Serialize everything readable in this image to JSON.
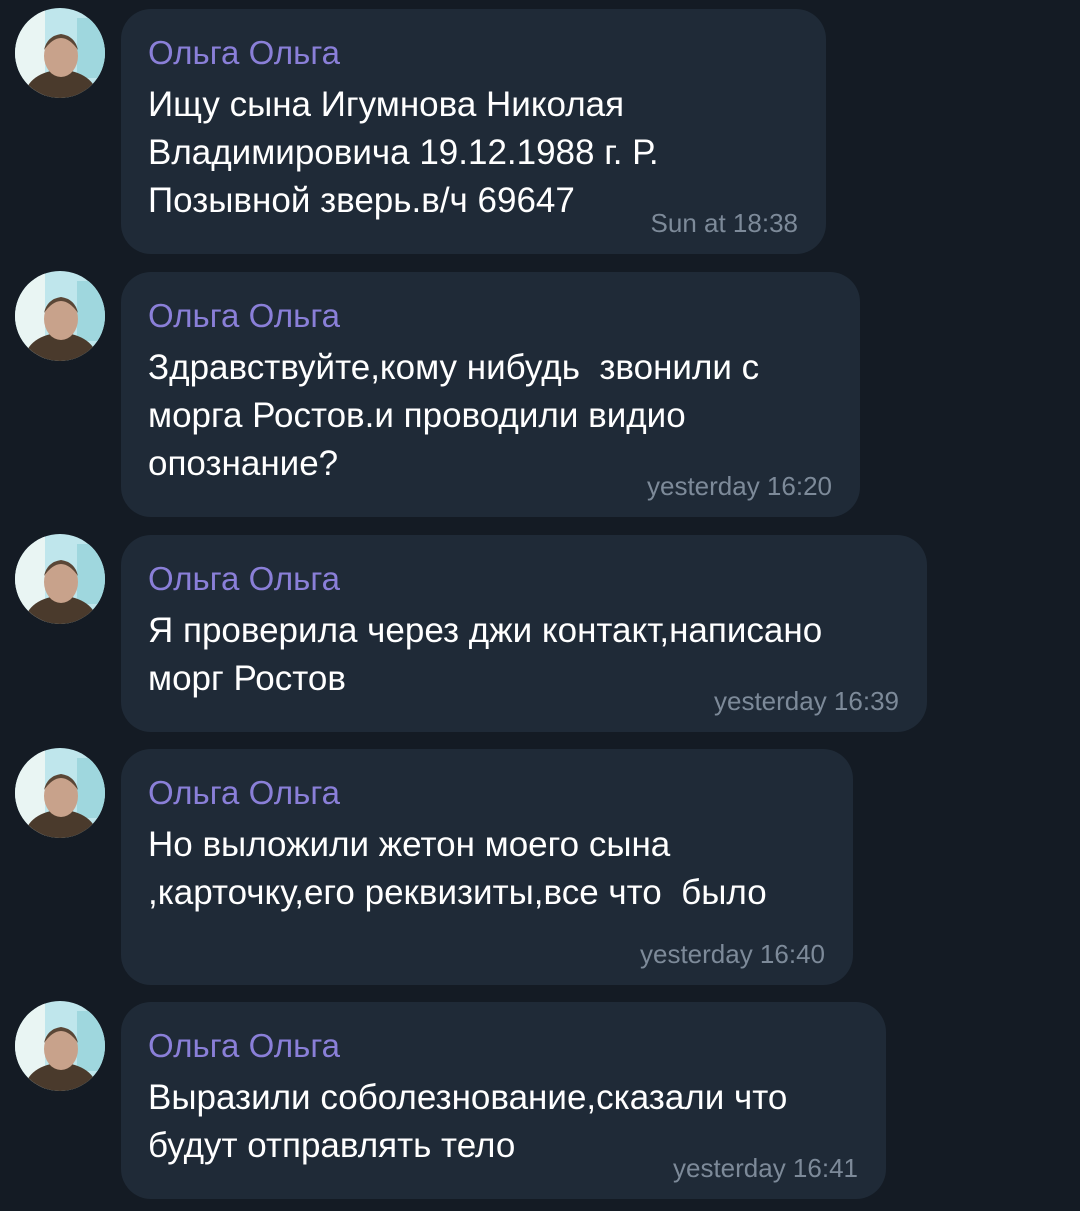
{
  "messages": [
    {
      "sender": "Ольга Ольга",
      "text": "Ищу сына Игумнова Николая\nВладимировича 19.12.1988 г. Р.\nПозывной зверь.в/ч 69647",
      "time": "Sun at 18:38"
    },
    {
      "sender": "Ольга Ольга",
      "text": "Здравствуйте,кому нибудь  звонили с\nморга Ростов.и проводили видио\nопознание?",
      "time": "yesterday 16:20"
    },
    {
      "sender": "Ольга Ольга",
      "text": "Я проверила через джи контакт,написано\nморг Ростов",
      "time": "yesterday 16:39"
    },
    {
      "sender": "Ольга Ольга",
      "text": "Но выложили жетон моего сына\n,карточку,его реквизиты,все что  было",
      "time": "yesterday 16:40"
    },
    {
      "sender": "Ольга Ольга",
      "text": "Выразили соболезнование,сказали что\nбудут отправлять тело",
      "time": "yesterday 16:41"
    }
  ],
  "colors": {
    "background": "#141b24",
    "bubble": "#1f2a37",
    "sender": "#8a7fd8",
    "text": "#ffffff",
    "time": "#7d8a99"
  }
}
